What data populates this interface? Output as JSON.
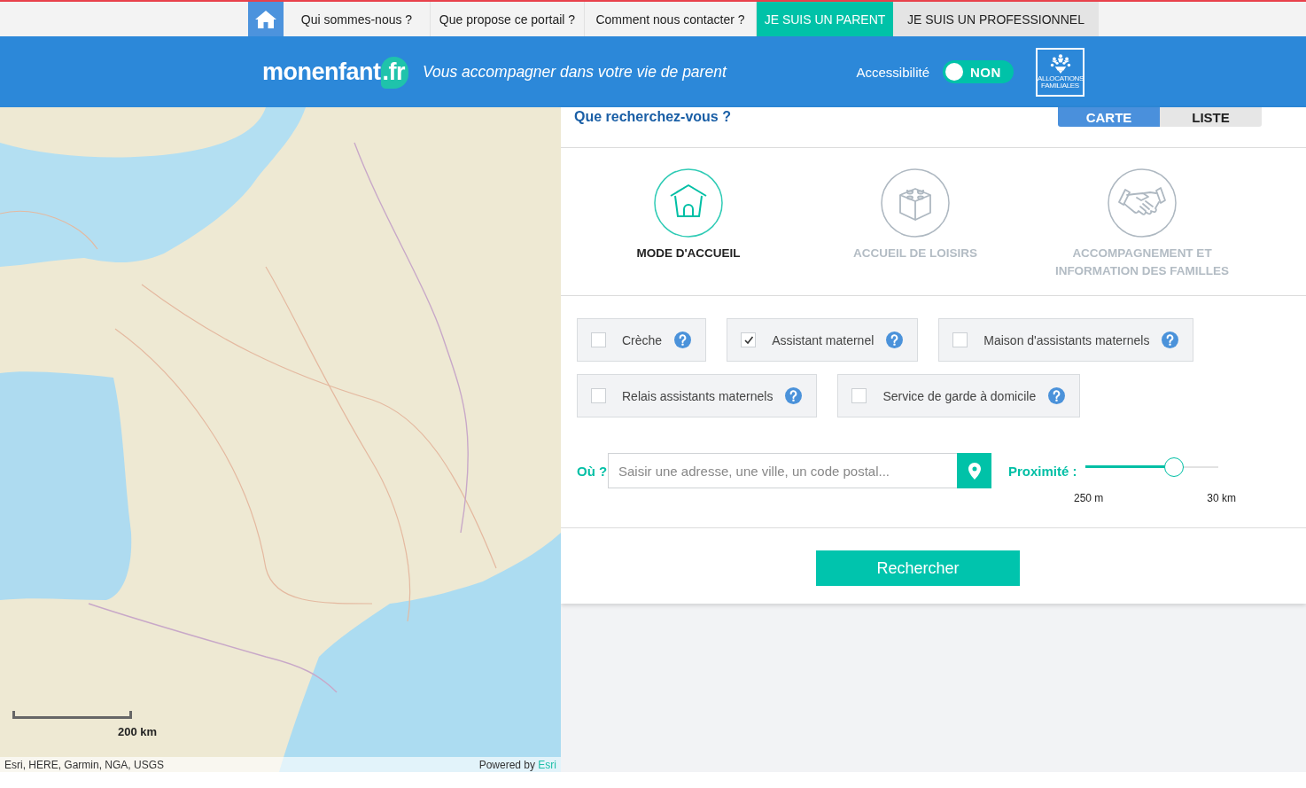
{
  "top_nav": {
    "links": [
      "Qui sommes-nous ?",
      "Que propose ce portail ?",
      "Comment nous contacter ?"
    ],
    "audience_tabs": [
      {
        "label": "JE SUIS UN PARENT",
        "selected": true
      },
      {
        "label": "JE SUIS UN PROFESSIONNEL",
        "selected": false
      }
    ]
  },
  "header": {
    "logo": {
      "name": "monenfant",
      "suffix": ".fr"
    },
    "tagline": "Vous accompagner dans votre vie de parent",
    "accessibility": {
      "label": "Accessibilité",
      "on": false,
      "state_text": "NON"
    },
    "partner_logo": {
      "caption": "ALLOCATIONS FAMILIALES"
    }
  },
  "map": {
    "scale": "200 km",
    "attribution": "Esri, HERE, Garmin, NGA, USGS",
    "powered_by": "Powered by",
    "powered_by_link": "Esri"
  },
  "search": {
    "title": "Que recherchez-vous ?",
    "view_tabs": [
      {
        "label": "CARTE",
        "selected": true
      },
      {
        "label": "LISTE",
        "selected": false
      }
    ],
    "categories": [
      {
        "label": "MODE D'ACCUEIL",
        "selected": true
      },
      {
        "label": "ACCUEIL DE LOISIRS",
        "selected": false
      },
      {
        "label": "ACCOMPAGNEMENT ET INFORMATION DES FAMILLES",
        "selected": false
      }
    ],
    "options": [
      {
        "label": "Crèche",
        "checked": false
      },
      {
        "label": "Assistant maternel",
        "checked": true
      },
      {
        "label": "Maison d'assistants maternels",
        "checked": false
      },
      {
        "label": "Relais assistants maternels",
        "checked": false
      },
      {
        "label": "Service de garde à domicile",
        "checked": false
      }
    ],
    "where": {
      "label": "Où ?",
      "placeholder": "Saisir une adresse, une ville, un code postal..."
    },
    "proximity": {
      "label": "Proximité :",
      "level": 0.667,
      "min_label": "250 m",
      "max_label": "30 km"
    },
    "submit": "Rechercher"
  }
}
